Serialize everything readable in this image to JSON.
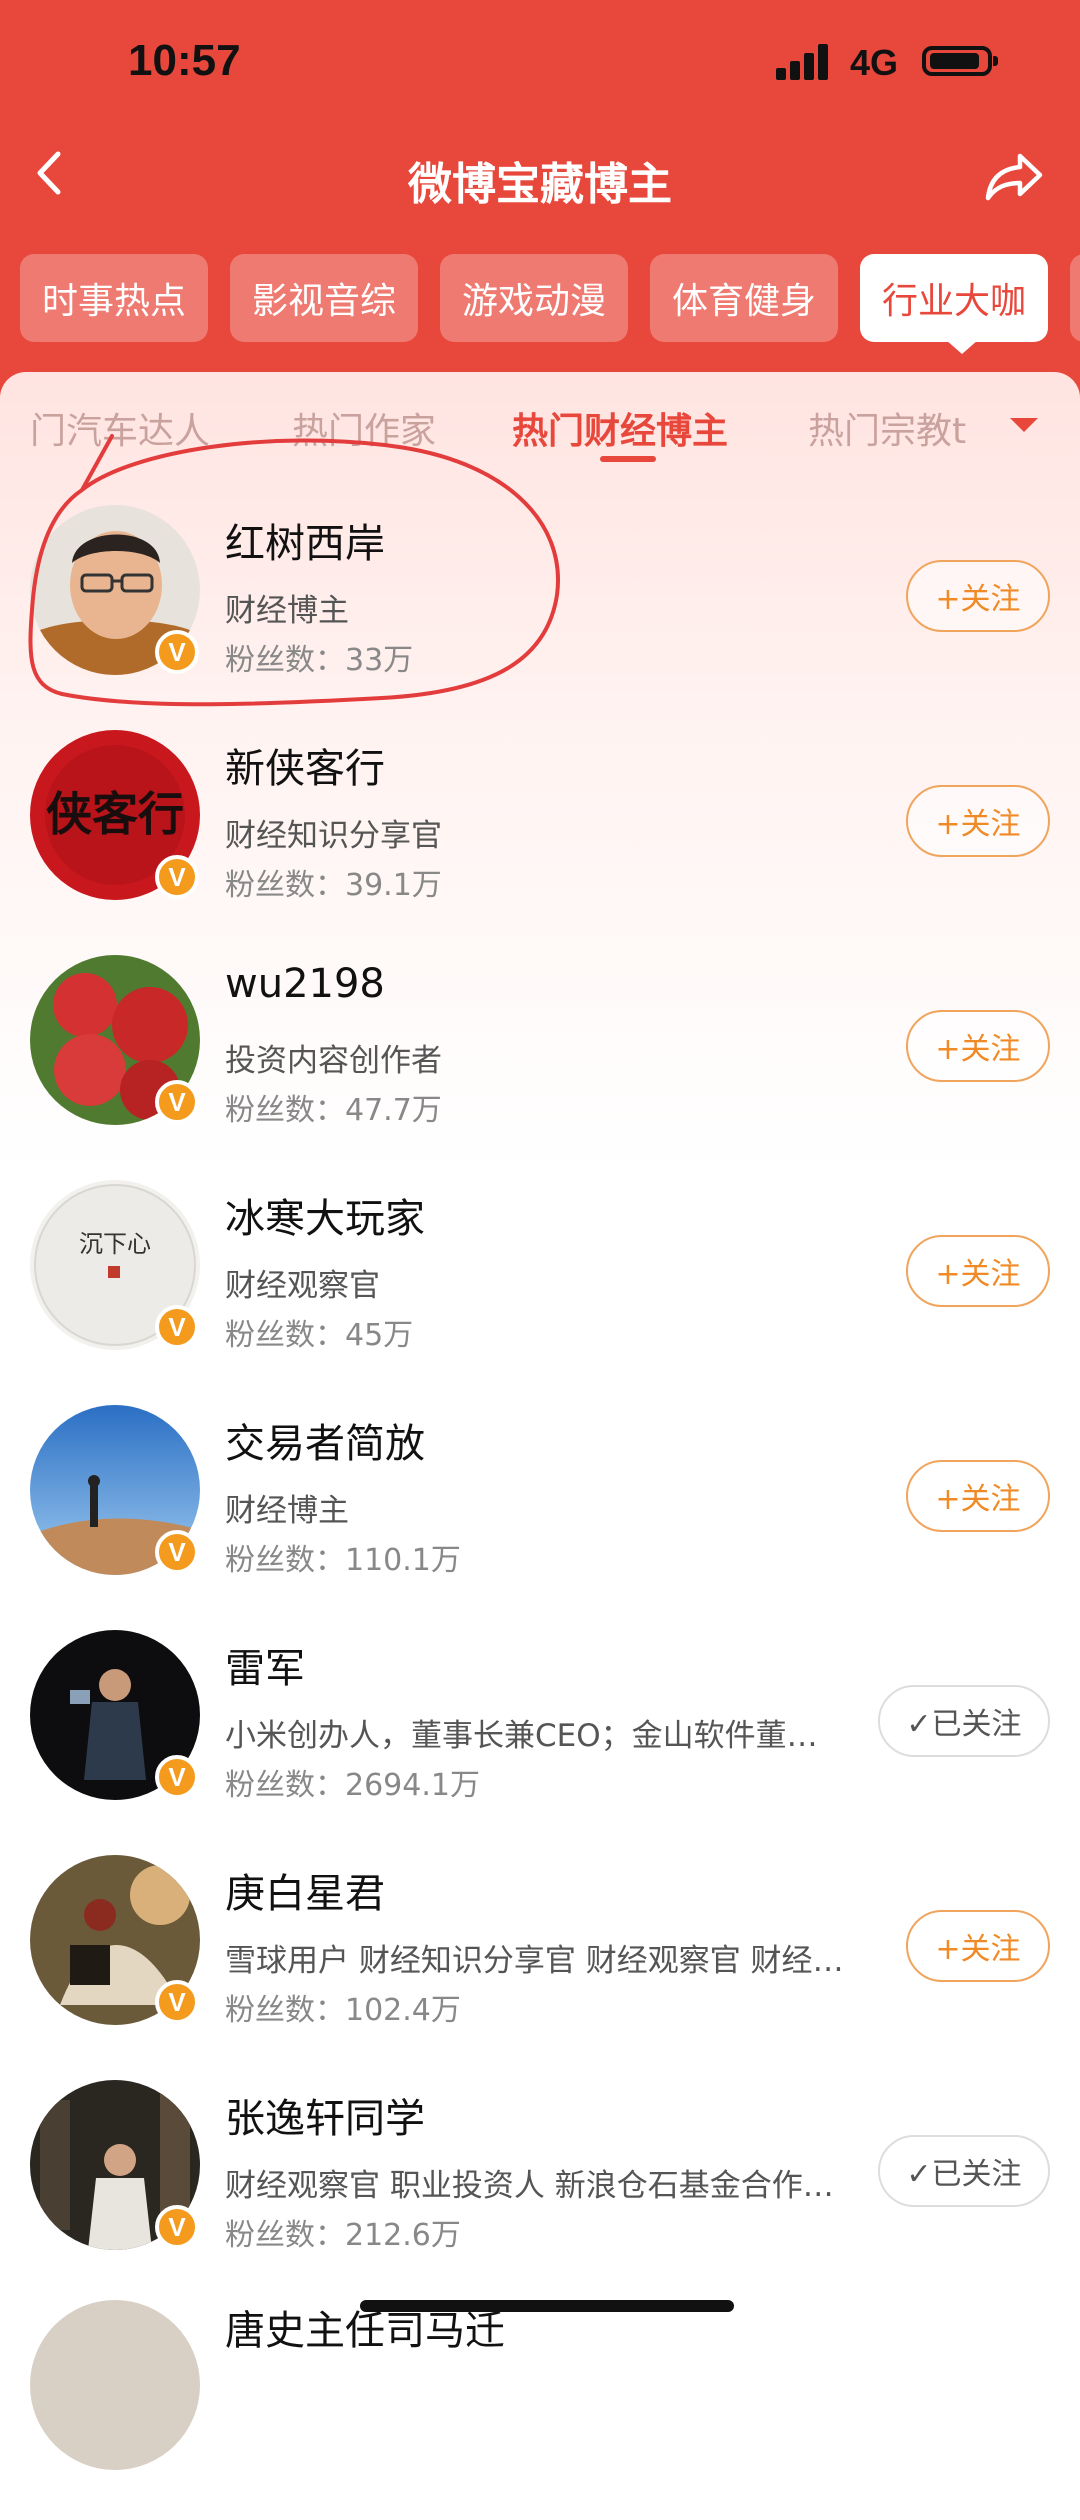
{
  "status_bar": {
    "time": "10:57",
    "network": "4G",
    "battery_level": 0.9
  },
  "nav": {
    "title": "微博宝藏博主",
    "back_icon": "back-arrow-icon",
    "share_icon": "share-icon"
  },
  "categories": [
    {
      "label": "时事热点",
      "active": false
    },
    {
      "label": "影视音综",
      "active": false
    },
    {
      "label": "游戏动漫",
      "active": false
    },
    {
      "label": "体育健身",
      "active": false
    },
    {
      "label": "行业大咖",
      "active": true
    }
  ],
  "subtabs": [
    {
      "label": "门汽车达人",
      "active": false
    },
    {
      "label": "热门作家",
      "active": false
    },
    {
      "label": "热门财经博主",
      "active": true
    },
    {
      "label": "热门宗教t",
      "active": false
    }
  ],
  "list": [
    {
      "name": "红树西岸",
      "desc": "财经博主",
      "fans": "粉丝数：33万",
      "button": "+关注",
      "followed": false,
      "badge": "V"
    },
    {
      "name": "新侠客行",
      "desc": "财经知识分享官",
      "fans": "粉丝数：39.1万",
      "button": "+关注",
      "followed": false,
      "badge": "V"
    },
    {
      "name": "wu2198",
      "desc": "投资内容创作者",
      "fans": "粉丝数：47.7万",
      "button": "+关注",
      "followed": false,
      "badge": "V"
    },
    {
      "name": "冰寒大玩家",
      "desc": "财经观察官",
      "fans": "粉丝数：45万",
      "button": "+关注",
      "followed": false,
      "badge": "V"
    },
    {
      "name": "交易者简放",
      "desc": "财经博主",
      "fans": "粉丝数：110.1万",
      "button": "+关注",
      "followed": false,
      "badge": "V"
    },
    {
      "name": "雷军",
      "desc": "小米创办人，董事长兼CEO；金山软件董事…",
      "fans": "粉丝数：2694.1万",
      "button": "✓已关注",
      "followed": true,
      "badge": "V"
    },
    {
      "name": "庚白星君",
      "desc": "雪球用户 财经知识分享官 财经观察官 财经博…",
      "fans": "粉丝数：102.4万",
      "button": "+关注",
      "followed": false,
      "badge": "V"
    },
    {
      "name": "张逸轩同学",
      "desc": "财经观察官 职业投资人 新浪仓石基金合作作…",
      "fans": "粉丝数：212.6万",
      "button": "✓已关注",
      "followed": true,
      "badge": "V"
    },
    {
      "name": "唐史主任司马迁",
      "desc": "",
      "fans": "",
      "button": "",
      "followed": false,
      "badge": ""
    }
  ],
  "avatar_art": {
    "xiakexing_text": "侠客行",
    "bingham_text": "沉下心"
  },
  "colors": {
    "brand_red": "#e8473b",
    "follow_orange": "#f08a26",
    "verified_badge": "#f49a1d",
    "annotation_red": "#e33c3c"
  }
}
